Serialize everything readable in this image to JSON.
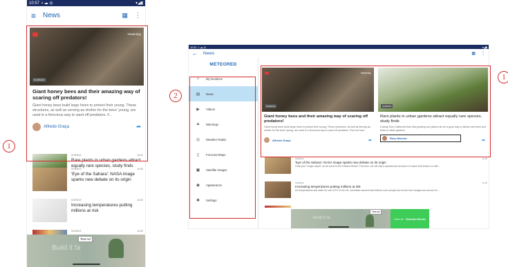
{
  "phone": {
    "status": {
      "time": "10:57"
    },
    "title": "News",
    "featured": {
      "date": "Yesterday",
      "tag": "SCIENCE",
      "headline": "Giant honey bees and their amazing way of scaring off predators!",
      "summary": "Giant honey bees build large hives to protect their young. These structures, as well as serving as shelter for the bees' young, are used in a ferocious way to ward off predators. F...",
      "author": "Alfredo Graça"
    },
    "rows": [
      {
        "category": "SCIENCE",
        "date": "Jul 31",
        "title": "Rare plants in urban gardens attract equally rare species, study finds"
      },
      {
        "category": "SCIENCE",
        "date": "Jul 30",
        "title": "'Eye of the Sahara': NASA image sparks new debate on its origin"
      },
      {
        "category": "SCIENCE",
        "date": "Jul 30",
        "title": "Increasing temperatures putting millions at risk"
      },
      {
        "category": "SCIENCE",
        "date": "Jul 29",
        "title": ""
      }
    ],
    "ad": {
      "label": "Test Ad",
      "text": "Build it fa"
    }
  },
  "tablet": {
    "status": {
      "time": "10:57"
    },
    "title": "News",
    "drawer": {
      "logo": "METEORED",
      "items": [
        {
          "label": "My locations",
          "icon": "home-icon"
        },
        {
          "label": "News",
          "icon": "news-icon"
        },
        {
          "label": "Videos",
          "icon": "play-icon"
        },
        {
          "label": "Warnings",
          "icon": "warning-icon"
        },
        {
          "label": "Weather Radar",
          "icon": "radar-icon"
        },
        {
          "label": "Forecast Maps",
          "icon": "map-icon"
        },
        {
          "label": "Satellite Images",
          "icon": "satellite-icon"
        },
        {
          "label": "Appearance",
          "icon": "palette-icon"
        },
        {
          "label": "Settings",
          "icon": "gear-icon"
        }
      ]
    },
    "card1": {
      "date": "Yesterday",
      "tag": "SCIENCE",
      "headline": "Giant honey bees and their amazing way of scaring off predators!",
      "summary": "Giant honey bees build large hives to protect their young. These structures, as well as serving as shelter for the bees' young, are used in a ferocious way to ward off predators. Find out how!",
      "author": "Alfredo Graça"
    },
    "card2": {
      "tag": "SCIENCE",
      "headline": "Rare plants in urban gardens attract equally rare species, study finds",
      "summary": "A study from California finds that growing rare plants can be a good way to attract rare bees and birds to urban gardens.",
      "author": "Rory Morrow"
    },
    "rows": [
      {
        "category": "SCIENCE",
        "date": "Jul 30",
        "title": "'Eye of the Sahara': NASA image sparks new debate on its origin",
        "summary": "Grab your 'magic carpet' as we travel to the Sahara Desert. This time, we will visit a spectacular structure of nature that leaves us with..."
      },
      {
        "category": "SCIENCE",
        "date": "Jul 30",
        "title": "Increasing temperatures putting millions at risk",
        "summary": "As temperatures last week hit over 40°C in the UK, scientists warned that millions more people are at risk from dangerous summer te..."
      }
    ],
    "ad": {
      "label": "Test Ad",
      "text": "Build it fa",
      "brand": "Schneider Electric",
      "tagline": "Life is On"
    }
  },
  "annotations": {
    "one": "1",
    "two": "2"
  },
  "colors": {
    "brand": "#1e63b3",
    "statusbar": "#1b2c63",
    "highlight": "#d62828",
    "selected": "#bde0f5"
  }
}
